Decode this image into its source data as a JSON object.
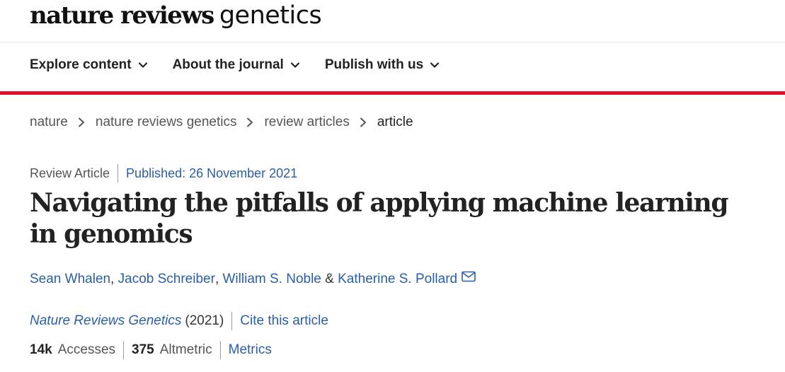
{
  "logo": {
    "bold_text": "nature reviews",
    "light_text": "genetics"
  },
  "nav": {
    "items": [
      {
        "label": "Explore content"
      },
      {
        "label": "About the journal"
      },
      {
        "label": "Publish with us"
      }
    ]
  },
  "breadcrumb": [
    "nature",
    "nature reviews genetics",
    "review articles",
    "article"
  ],
  "article": {
    "type": "Review Article",
    "published": "Published: 26 November 2021",
    "title": "Navigating the pitfalls of applying machine learning in genomics",
    "authors": [
      "Sean Whalen",
      "Jacob Schreiber",
      "William S. Noble",
      "Katherine S. Pollard"
    ],
    "author_sep": ",",
    "author_amp": "&",
    "journal": "Nature Reviews Genetics",
    "year": "(2021)",
    "cite_label": "Cite this article",
    "accesses_value": "14k",
    "accesses_label": "Accesses",
    "altmetric_value": "375",
    "altmetric_label": "Altmetric",
    "metrics_label": "Metrics"
  },
  "colors": {
    "accent_red": "#e0102f",
    "link_blue": "#2a5ea8"
  },
  "icons": {
    "nav_chevron": "chevron-down-icon",
    "breadcrumb_sep": "chevron-right-icon",
    "mail": "mail-icon"
  }
}
